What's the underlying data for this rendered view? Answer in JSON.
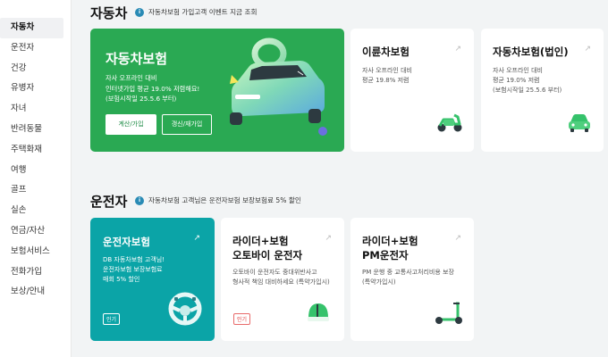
{
  "sidebar": {
    "items": [
      {
        "label": "자동차",
        "active": true
      },
      {
        "label": "운전자"
      },
      {
        "label": "건강"
      },
      {
        "label": "유병자"
      },
      {
        "label": "자녀"
      },
      {
        "label": "반려동물"
      },
      {
        "label": "주택화재"
      },
      {
        "label": "여행"
      },
      {
        "label": "골프"
      },
      {
        "label": "실손"
      },
      {
        "label": "연금/자산"
      },
      {
        "label": "보험서비스"
      },
      {
        "label": "전화가입"
      },
      {
        "label": "보상/안내"
      }
    ]
  },
  "car_section": {
    "title": "자동차",
    "note": "자동차보험 가입고객 이벤트 지금 조회",
    "hero": {
      "title": "자동차보험",
      "desc1": "자사 오프라인 대비",
      "desc2": "인터넷가입 평균 19.0% 저렴해요!",
      "desc3": "(보험시작일 25.5.6 부터)",
      "btn_primary": "계산/가입",
      "btn_secondary": "갱신/재가입"
    },
    "bike": {
      "title": "이륜차보험",
      "desc1": "자사 오프라인 대비",
      "desc2": "평균 19.8% 저렴"
    },
    "corp": {
      "title": "자동차보험(법인)",
      "desc1": "자사 오프라인 대비",
      "desc2": "평균 19.0% 저렴",
      "desc3": "(보험시작일 25.5.6 부터)"
    }
  },
  "driver_section": {
    "title": "운전자",
    "note": "자동차보험 고객님은 운전자보험 보장보험료 5% 할인",
    "driver": {
      "title": "운전자보험",
      "desc1": "DB 자동차보험 고객님!",
      "desc2": "운전자보험 보장보험료",
      "desc3": "매회 5% 할인",
      "badge": "인기"
    },
    "rider": {
      "title1": "라이더+보험",
      "title2": "오토바이 운전자",
      "desc1": "오토바이 운전자도 중대위반사고",
      "desc2": "형사적 책임 대비하세요 (특약가입시)",
      "badge": "인기"
    },
    "pm": {
      "title1": "라이더+보험",
      "title2": "PM운전자",
      "desc1": "PM 운행 중 교통사고처리비용 보장",
      "desc2": "(특약가입시)"
    }
  },
  "colors": {
    "hero_green": "#2aa953",
    "teal": "#0ba4a7",
    "accent_green": "#35c26b"
  }
}
